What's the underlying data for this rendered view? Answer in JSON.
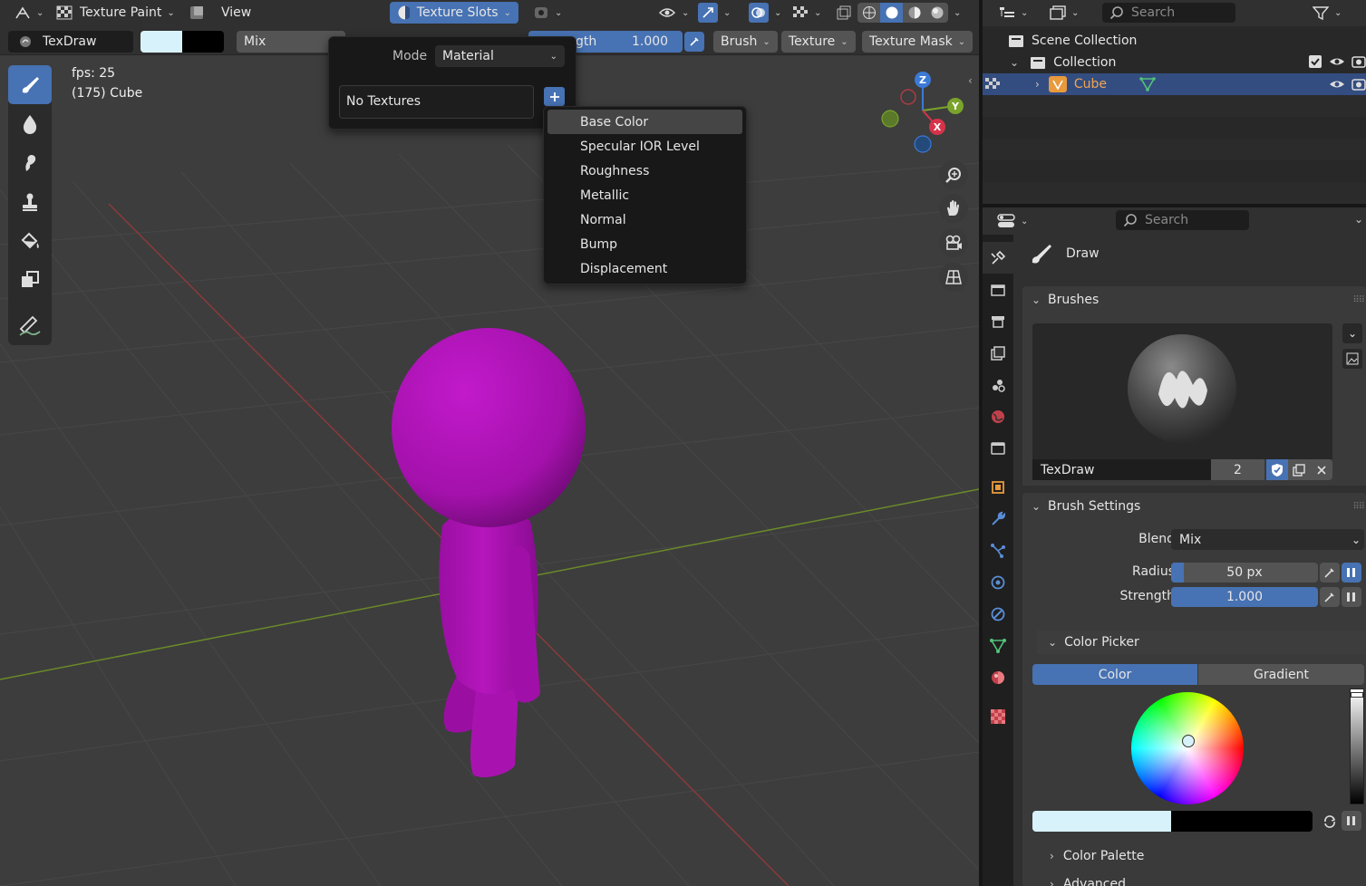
{
  "header": {
    "editor_mode": "Texture Paint",
    "view_menu": "View",
    "texture_slots": "Texture Slots"
  },
  "toolbar": {
    "brush_name": "TexDraw",
    "blend": "Mix",
    "strength_label": "gth",
    "strength_value": "1.000",
    "brush_menu": "Brush",
    "texture_menu": "Texture",
    "texture_mask_menu": "Texture Mask"
  },
  "viewport": {
    "fps": "fps: 25",
    "object_info": "(175) Cube",
    "gizmo": {
      "z": "Z",
      "y": "Y",
      "x": "X"
    }
  },
  "texture_slots_popup": {
    "mode_label": "Mode",
    "mode_value": "Material",
    "no_textures": "No Textures",
    "add_menu": [
      "Base Color",
      "Specular IOR Level",
      "Roughness",
      "Metallic",
      "Normal",
      "Bump",
      "Displacement"
    ]
  },
  "outliner": {
    "search_placeholder": "Search",
    "scene_collection": "Scene Collection",
    "collection": "Collection",
    "object": "Cube"
  },
  "properties": {
    "search_placeholder": "Search",
    "tool_name": "Draw",
    "brushes_panel": "Brushes",
    "brush_name": "TexDraw",
    "brush_users": "2",
    "brush_settings_panel": "Brush Settings",
    "blend_label": "Blend",
    "blend_value": "Mix",
    "radius_label": "Radius",
    "radius_value": "50 px",
    "strength_label": "Strength",
    "strength_value": "1.000",
    "color_picker_panel": "Color Picker",
    "color_tab": "Color",
    "gradient_tab": "Gradient",
    "color_palette_panel": "Color Palette",
    "advanced_panel": "Advanced"
  },
  "colors": {
    "accent": "#4772b3",
    "object": "#b015b8",
    "primary_color": "#d8f2fb",
    "secondary_color": "#000000",
    "orange": "#e89a3c"
  }
}
